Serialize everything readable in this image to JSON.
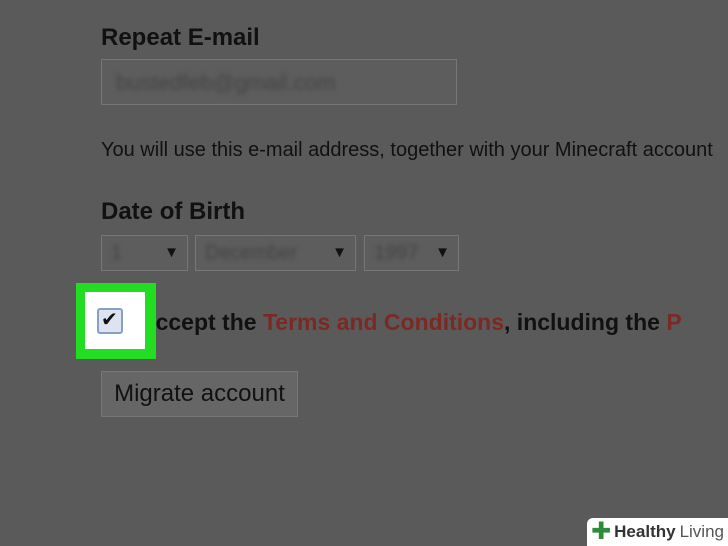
{
  "form": {
    "repeat_email_label": "Repeat E-mail",
    "repeat_email_value": "bustedfeb@gmail.com",
    "email_note": "You will use this e-mail address, together with your Minecraft account",
    "dob_label": "Date of Birth",
    "dob_day": "1",
    "dob_month": "December",
    "dob_year": "1997",
    "accept_prefix": "I accept the ",
    "terms_link": "Terms and Conditions",
    "accept_middle": ", including the ",
    "accept_tail": "P",
    "migrate_button": "Migrate account"
  },
  "checkbox_checked": true,
  "logo": {
    "brand_bold": "Healthy",
    "brand_light": "Living"
  },
  "colors": {
    "highlight": "#22dd22",
    "link": "#7a2a22",
    "logo_plus": "#2e8b3c"
  }
}
